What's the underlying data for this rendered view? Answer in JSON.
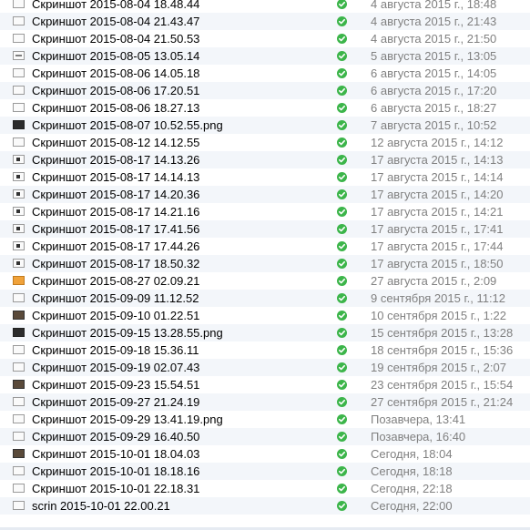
{
  "files": [
    {
      "name": "Скриншот 2015-08-04 18.48.44",
      "date": "4 августа 2015 г., 18:48",
      "thumb": "plain"
    },
    {
      "name": "Скриншот 2015-08-04 21.43.47",
      "date": "4 августа 2015 г., 21:43",
      "thumb": "plain"
    },
    {
      "name": "Скриншот 2015-08-04 21.50.53",
      "date": "4 августа 2015 г., 21:50",
      "thumb": "plain"
    },
    {
      "name": "Скриншот 2015-08-05 13.05.14",
      "date": "5 августа 2015 г., 13:05",
      "thumb": "mid"
    },
    {
      "name": "Скриншот 2015-08-06 14.05.18",
      "date": "6 августа 2015 г., 14:05",
      "thumb": "plain"
    },
    {
      "name": "Скриншот 2015-08-06 17.20.51",
      "date": "6 августа 2015 г., 17:20",
      "thumb": "plain"
    },
    {
      "name": "Скриншот 2015-08-06 18.27.13",
      "date": "6 августа 2015 г., 18:27",
      "thumb": "plain"
    },
    {
      "name": "Скриншот 2015-08-07 10.52.55.png",
      "date": "7 августа 2015 г., 10:52",
      "thumb": "dark"
    },
    {
      "name": "Скриншот 2015-08-12 14.12.55",
      "date": "12 августа 2015 г., 14:12",
      "thumb": "plain"
    },
    {
      "name": "Скриншот 2015-08-17 14.13.26",
      "date": "17 августа 2015 г., 14:13",
      "thumb": "dot"
    },
    {
      "name": "Скриншот 2015-08-17 14.14.13",
      "date": "17 августа 2015 г., 14:14",
      "thumb": "dot"
    },
    {
      "name": "Скриншот 2015-08-17 14.20.36",
      "date": "17 августа 2015 г., 14:20",
      "thumb": "dot"
    },
    {
      "name": "Скриншот 2015-08-17 14.21.16",
      "date": "17 августа 2015 г., 14:21",
      "thumb": "dot"
    },
    {
      "name": "Скриншот 2015-08-17 17.41.56",
      "date": "17 августа 2015 г., 17:41",
      "thumb": "dot"
    },
    {
      "name": "Скриншот 2015-08-17 17.44.26",
      "date": "17 августа 2015 г., 17:44",
      "thumb": "dot"
    },
    {
      "name": "Скриншот 2015-08-17 18.50.32",
      "date": "17 августа 2015 г., 18:50",
      "thumb": "dot"
    },
    {
      "name": "Скриншот 2015-08-27 02.09.21",
      "date": "27 августа 2015 г., 2:09",
      "thumb": "orange"
    },
    {
      "name": "Скриншот 2015-09-09 11.12.52",
      "date": "9 сентября 2015 г., 11:12",
      "thumb": "plain"
    },
    {
      "name": "Скриншот 2015-09-10 01.22.51",
      "date": "10 сентября 2015 г., 1:22",
      "thumb": "pic"
    },
    {
      "name": "Скриншот 2015-09-15 13.28.55.png",
      "date": "15 сентября 2015 г., 13:28",
      "thumb": "dark"
    },
    {
      "name": "Скриншот 2015-09-18 15.36.11",
      "date": "18 сентября 2015 г., 15:36",
      "thumb": "plain"
    },
    {
      "name": "Скриншот 2015-09-19 02.07.43",
      "date": "19 сентября 2015 г., 2:07",
      "thumb": "plain"
    },
    {
      "name": "Скриншот 2015-09-23 15.54.51",
      "date": "23 сентября 2015 г., 15:54",
      "thumb": "pic"
    },
    {
      "name": "Скриншот 2015-09-27 21.24.19",
      "date": "27 сентября 2015 г., 21:24",
      "thumb": "plain"
    },
    {
      "name": "Скриншот 2015-09-29 13.41.19.png",
      "date": "Позавчера, 13:41",
      "thumb": "plain"
    },
    {
      "name": "Скриншот 2015-09-29 16.40.50",
      "date": "Позавчера, 16:40",
      "thumb": "plain"
    },
    {
      "name": "Скриншот 2015-10-01 18.04.03",
      "date": "Сегодня, 18:04",
      "thumb": "pic"
    },
    {
      "name": "Скриншот 2015-10-01 18.18.16",
      "date": "Сегодня, 18:18",
      "thumb": "plain"
    },
    {
      "name": "Скриншот 2015-10-01 22.18.31",
      "date": "Сегодня, 22:18",
      "thumb": "plain"
    },
    {
      "name": "scrin 2015-10-01 22.00.21",
      "date": "Сегодня, 22:00",
      "thumb": "plain"
    }
  ],
  "status_icon": "check-circle-icon",
  "colors": {
    "status_green": "#3cb54a",
    "date_text": "#808080",
    "alt_row": "#f3f6fa"
  }
}
